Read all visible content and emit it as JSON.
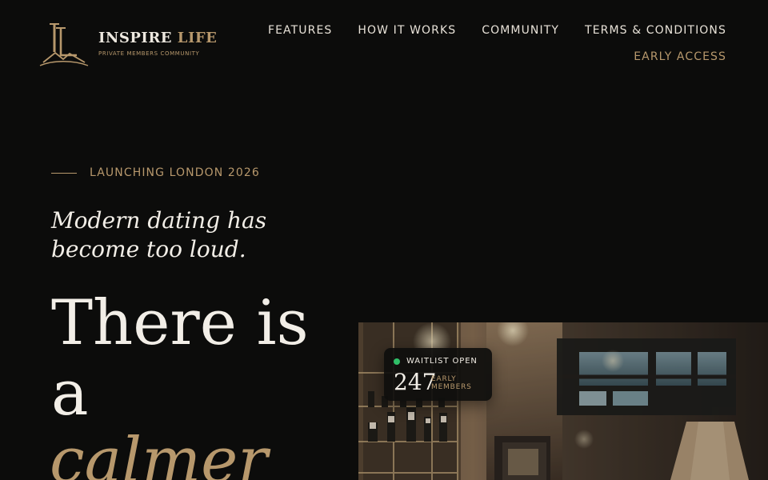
{
  "brand": {
    "name_main": "INSPIRE",
    "name_accent": "LIFE",
    "tagline": "PRIVATE MEMBERS COMMUNITY",
    "monogram": "ILL"
  },
  "nav": {
    "items": [
      {
        "label": "FEATURES"
      },
      {
        "label": "HOW IT WORKS"
      },
      {
        "label": "COMMUNITY"
      },
      {
        "label": "TERMS & CONDITIONS"
      }
    ],
    "cta_label": "EARLY ACCESS"
  },
  "hero": {
    "eyebrow": "LAUNCHING LONDON 2026",
    "subhead": "Modern dating has become too loud.",
    "headline_line1": "There is",
    "headline_line2": "a",
    "headline_accent": "calmer"
  },
  "waitlist": {
    "status": "WAITLIST OPEN",
    "count": "247",
    "caption": "EARLY MEMBERS"
  },
  "colors": {
    "background": "#0c0c0b",
    "text": "#ede8df",
    "accent": "#b7986c",
    "status_green": "#2fbf68"
  },
  "icons": {
    "logo": "brand-monogram-icon",
    "status": "status-dot-icon"
  }
}
